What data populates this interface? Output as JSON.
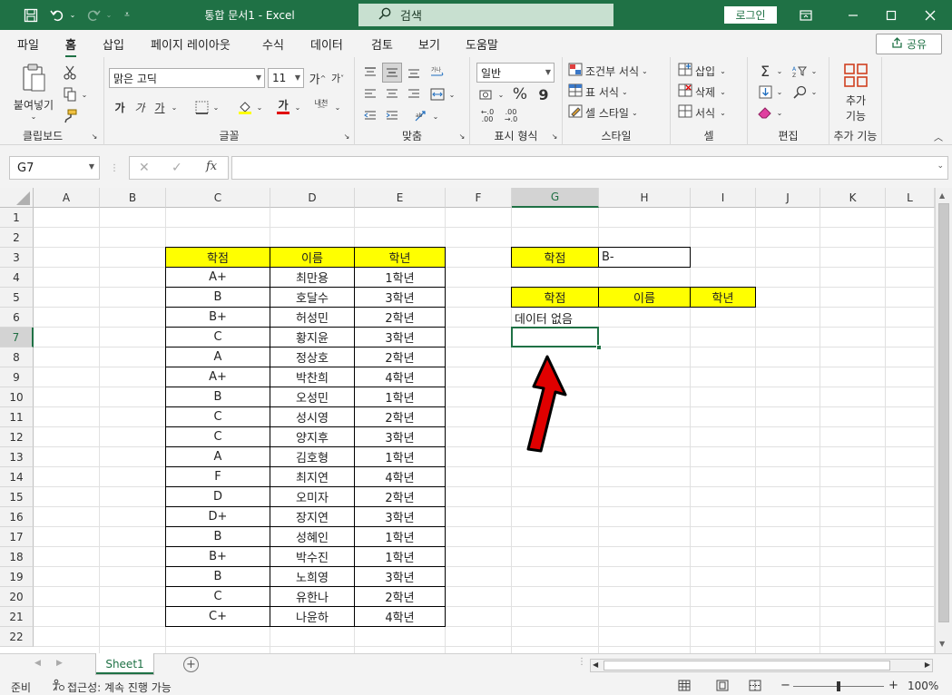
{
  "titlebar": {
    "save_icon": "save-icon",
    "title": "통합 문서1  -  Excel",
    "search_placeholder": "검색",
    "login_label": "로그인"
  },
  "tabs": [
    "파일",
    "홈",
    "삽입",
    "페이지 레이아웃",
    "수식",
    "데이터",
    "검토",
    "보기",
    "도움말"
  ],
  "active_tab": "홈",
  "share_label": "공유",
  "ribbon": {
    "clipboard": {
      "paste_label": "붙여넣기",
      "group_label": "클립보드"
    },
    "font": {
      "font_name": "맑은 고딕",
      "font_size": "11",
      "group_label": "글꼴",
      "bold": "가",
      "italic": "가",
      "underline": "가",
      "font_color_glyph": "가",
      "phonetic": "내천"
    },
    "alignment": {
      "group_label": "맞춤"
    },
    "number": {
      "format": "일반",
      "percent": "%",
      "comma": "9",
      "group_label": "표시 형식"
    },
    "styles": {
      "conditional": "조건부 서식",
      "table": "표 서식",
      "cell_style": "셀 스타일",
      "group_label": "스타일"
    },
    "cells": {
      "insert": "삽입",
      "delete": "삭제",
      "format": "서식",
      "group_label": "셀"
    },
    "editing": {
      "group_label": "편집"
    },
    "addins": {
      "label_line1": "추가",
      "label_line2": "기능",
      "group_label": "추가 기능"
    }
  },
  "formula_bar": {
    "name_box": "G7",
    "formula": ""
  },
  "columns": [
    "A",
    "B",
    "C",
    "D",
    "E",
    "F",
    "G",
    "H",
    "I",
    "J",
    "K",
    "L"
  ],
  "rows": [
    "1",
    "2",
    "3",
    "4",
    "5",
    "6",
    "7",
    "8",
    "9",
    "10",
    "11",
    "12",
    "13",
    "14",
    "15",
    "16",
    "17",
    "18",
    "19",
    "20",
    "21",
    "22"
  ],
  "selected_cell": "G7",
  "table_headers": [
    "학점",
    "이름",
    "학년"
  ],
  "table_rows": [
    [
      "A+",
      "최만용",
      "1학년"
    ],
    [
      "B",
      "호달수",
      "3학년"
    ],
    [
      "B+",
      "허성민",
      "2학년"
    ],
    [
      "C",
      "황지윤",
      "3학년"
    ],
    [
      "A",
      "정상호",
      "2학년"
    ],
    [
      "A+",
      "박찬희",
      "4학년"
    ],
    [
      "B",
      "오성민",
      "1학년"
    ],
    [
      "C",
      "성시영",
      "2학년"
    ],
    [
      "C",
      "양지후",
      "3학년"
    ],
    [
      "A",
      "김호형",
      "1학년"
    ],
    [
      "F",
      "최지연",
      "4학년"
    ],
    [
      "D",
      "오미자",
      "2학년"
    ],
    [
      "D+",
      "장지연",
      "3학년"
    ],
    [
      "B",
      "성혜인",
      "1학년"
    ],
    [
      "B+",
      "박수진",
      "1학년"
    ],
    [
      "B",
      "노희영",
      "3학년"
    ],
    [
      "C",
      "유한나",
      "2학년"
    ],
    [
      "C+",
      "나윤하",
      "4학년"
    ]
  ],
  "criteria": {
    "label": "학점",
    "value": "B-"
  },
  "result_headers": [
    "학점",
    "이름",
    "학년"
  ],
  "result_message": "데이터 없음",
  "sheet_tab": "Sheet1",
  "status": {
    "ready": "준비",
    "accessibility": "접근성: 계속 진행 가능",
    "zoom": "100%"
  },
  "colors": {
    "excel_green": "#1f7145",
    "header_yellow": "#ffff00",
    "arrow_red": "#e00000"
  }
}
